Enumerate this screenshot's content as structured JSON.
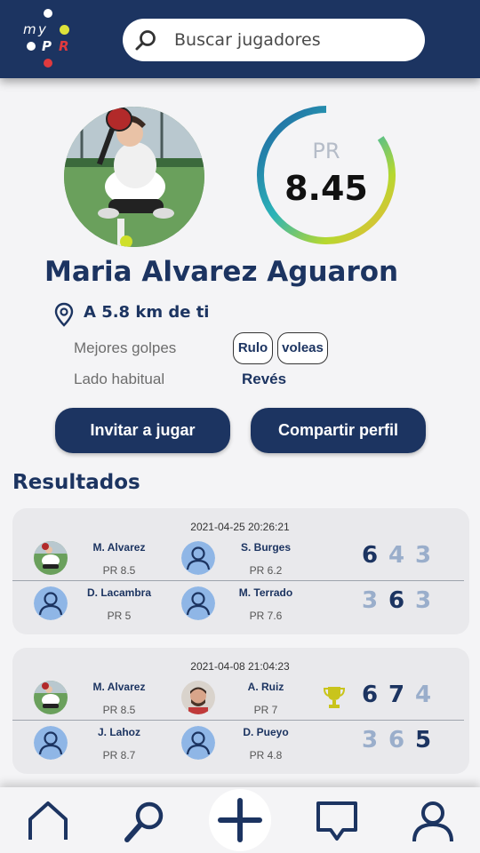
{
  "brand": {
    "logo_letters": [
      "m",
      "y",
      "P",
      "R"
    ]
  },
  "search": {
    "placeholder": "Buscar jugadores",
    "value": ""
  },
  "profile": {
    "name": "Maria Alvarez Aguaron",
    "rating_label": "PR",
    "rating": "8.45",
    "rating_fill": 0.845,
    "distance": "A 5.8 km de ti",
    "best_shots_label": "Mejores golpes",
    "best_shots": [
      "Rulo",
      "voleas"
    ],
    "side_label": "Lado habitual",
    "side_value": "Revés"
  },
  "actions": {
    "invite": "Invitar a jugar",
    "share": "Compartir perfil"
  },
  "results": {
    "title": "Resultados",
    "matches": [
      {
        "date": "2021-04-25 20:26:21",
        "teams": [
          {
            "players": [
              {
                "name": "M. Alvarez",
                "rating": "PR 8.5",
                "photo": true
              },
              {
                "name": "S. Burges",
                "rating": "PR 6.2",
                "photo": false
              }
            ],
            "scores": [
              "6",
              "4",
              "3"
            ],
            "set_won": [
              true,
              false,
              false
            ],
            "trophy": false
          },
          {
            "players": [
              {
                "name": "D. Lacambra",
                "rating": "PR 5",
                "photo": false
              },
              {
                "name": "M. Terrado",
                "rating": "PR 7.6",
                "photo": false
              }
            ],
            "scores": [
              "3",
              "6",
              "3"
            ],
            "set_won": [
              false,
              true,
              false
            ],
            "trophy": false
          }
        ]
      },
      {
        "date": "2021-04-08 21:04:23",
        "teams": [
          {
            "players": [
              {
                "name": "M. Alvarez",
                "rating": "PR 8.5",
                "photo": true
              },
              {
                "name": "A. Ruiz",
                "rating": "PR 7",
                "photo": true
              }
            ],
            "scores": [
              "6",
              "7",
              "4"
            ],
            "set_won": [
              true,
              true,
              false
            ],
            "trophy": true
          },
          {
            "players": [
              {
                "name": "J. Lahoz",
                "rating": "PR 8.7",
                "photo": false
              },
              {
                "name": "D. Pueyo",
                "rating": "PR 4.8",
                "photo": false
              }
            ],
            "scores": [
              "3",
              "6",
              "5"
            ],
            "set_won": [
              false,
              false,
              true
            ],
            "trophy": false
          }
        ]
      }
    ]
  },
  "nav": {
    "items": [
      "home-icon",
      "search-icon",
      "add-icon",
      "chat-icon",
      "profile-icon"
    ]
  },
  "colors": {
    "primary": "#1c3461",
    "score_win": "#1c3461",
    "score_lose": "#9aaecb",
    "logo_red": "#e03a3e",
    "logo_yellow": "#dde23a",
    "trophy": "#c9c41c"
  }
}
